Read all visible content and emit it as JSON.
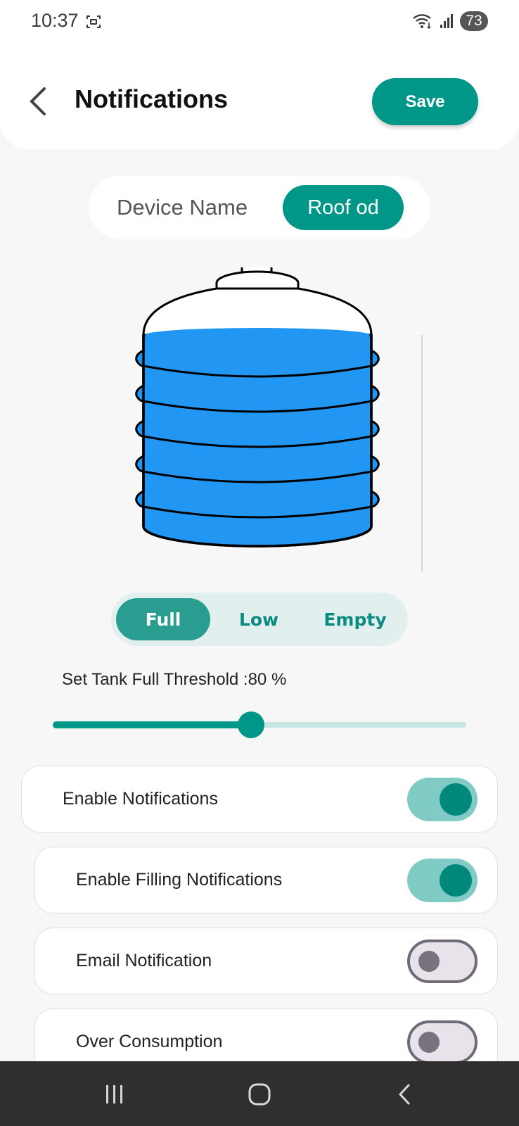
{
  "status_bar": {
    "time": "10:37",
    "battery": "73",
    "icons": [
      "screenshot-icon",
      "wifi-icon",
      "signal-icon"
    ]
  },
  "header": {
    "title": "Notifications",
    "save_label": "Save",
    "back_icon": "chevron-left-icon"
  },
  "device": {
    "label": "Device Name",
    "value": "Roof od"
  },
  "tank": {
    "icon": "water-tank-icon",
    "water_color": "#2196f3"
  },
  "level_tabs": [
    {
      "label": "Full",
      "active": true
    },
    {
      "label": "Low",
      "active": false
    },
    {
      "label": "Empty",
      "active": false
    }
  ],
  "threshold": {
    "label": "Set Tank Full Threshold :80 %",
    "slider_fraction": 0.48
  },
  "settings": [
    {
      "label": "Enable Notifications",
      "enabled": true
    },
    {
      "label": "Enable Filling Notifications",
      "enabled": true
    },
    {
      "label": "Email Notification",
      "enabled": false
    },
    {
      "label": "Over Consumption",
      "enabled": false
    }
  ],
  "colors": {
    "accent": "#009688",
    "toggle_on_track": "#80cbc4",
    "tab_background": "#e1f0ef",
    "nav_bar": "#2f2f2f"
  },
  "nav_bar": {
    "icons": [
      "recent-apps-icon",
      "home-icon",
      "back-icon"
    ]
  }
}
